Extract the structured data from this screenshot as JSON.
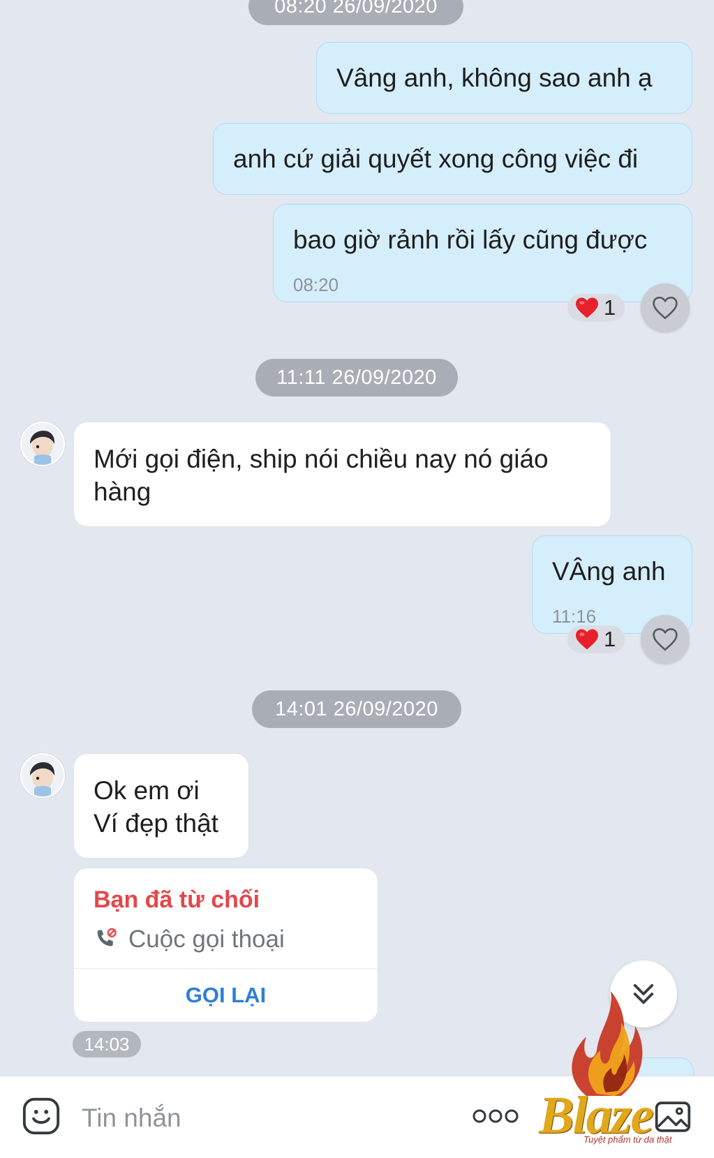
{
  "timestamps": {
    "ts1": "08:20 26/09/2020",
    "ts2": "11:11 26/09/2020",
    "ts3": "14:01 26/09/2020"
  },
  "messages": {
    "m1": "Vâng anh, không sao anh ạ",
    "m2": "anh cứ giải quyết xong công việc đi",
    "m3": "bao giờ rảnh rồi lấy cũng được",
    "m3_time": "08:20",
    "m3_reaction_count": "1",
    "m4_line1": "Mới gọi điện, ship nói chiều nay nó giáo",
    "m4_line2": "hàng",
    "m5": "VÂng anh",
    "m5_time": "11:16",
    "m5_reaction_count": "1",
    "m6_line1": "Ok em ơi",
    "m6_line2": "Ví đẹp thật"
  },
  "call_card": {
    "status": "Bạn đã từ chối",
    "type": "Cuộc gọi thoại",
    "action": "GỌI LẠI",
    "time": "14:03"
  },
  "input": {
    "placeholder": "Tin nhắn"
  },
  "watermark": {
    "brand": "Blaze",
    "tagline": "Tuyệt phẩm từ da thật"
  },
  "icons": {
    "reaction": "heart-icon",
    "like": "heart-outline-icon",
    "emoji": "emoji-icon",
    "more": "more-dots-icon",
    "image": "image-icon",
    "scroll": "double-chevron-down-icon",
    "call_declined": "phone-declined-icon"
  },
  "colors": {
    "background": "#e3e7ef",
    "outgoing_bubble": "#d5eefb",
    "incoming_bubble": "#ffffff",
    "declined": "#e4474a",
    "callback": "#2d7fd6"
  }
}
